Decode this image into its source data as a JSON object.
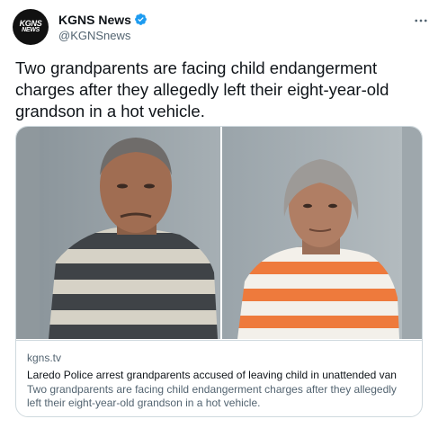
{
  "author": {
    "display_name": "KGNS News",
    "handle": "@KGNSnews",
    "logo_line1": "KGNS",
    "logo_line2": "NEWS",
    "verified": true
  },
  "tweet": {
    "text": "Two grandparents are facing child endangerment charges after they allegedly left their eight-year-old grandson in a hot vehicle."
  },
  "card": {
    "domain": "kgns.tv",
    "title": "Laredo Police arrest grandparents accused of leaving child in unattended van",
    "description": "Two grandparents are facing child endangerment charges after they allegedly left their eight-year-old grandson in a hot vehicle."
  },
  "icons": {
    "verified": "verified-badge-icon",
    "more": "more-options-icon"
  },
  "colors": {
    "verified_blue": "#1d9bf0",
    "text_primary": "#0f1419",
    "text_secondary": "#536471",
    "border": "#cfd9de"
  }
}
